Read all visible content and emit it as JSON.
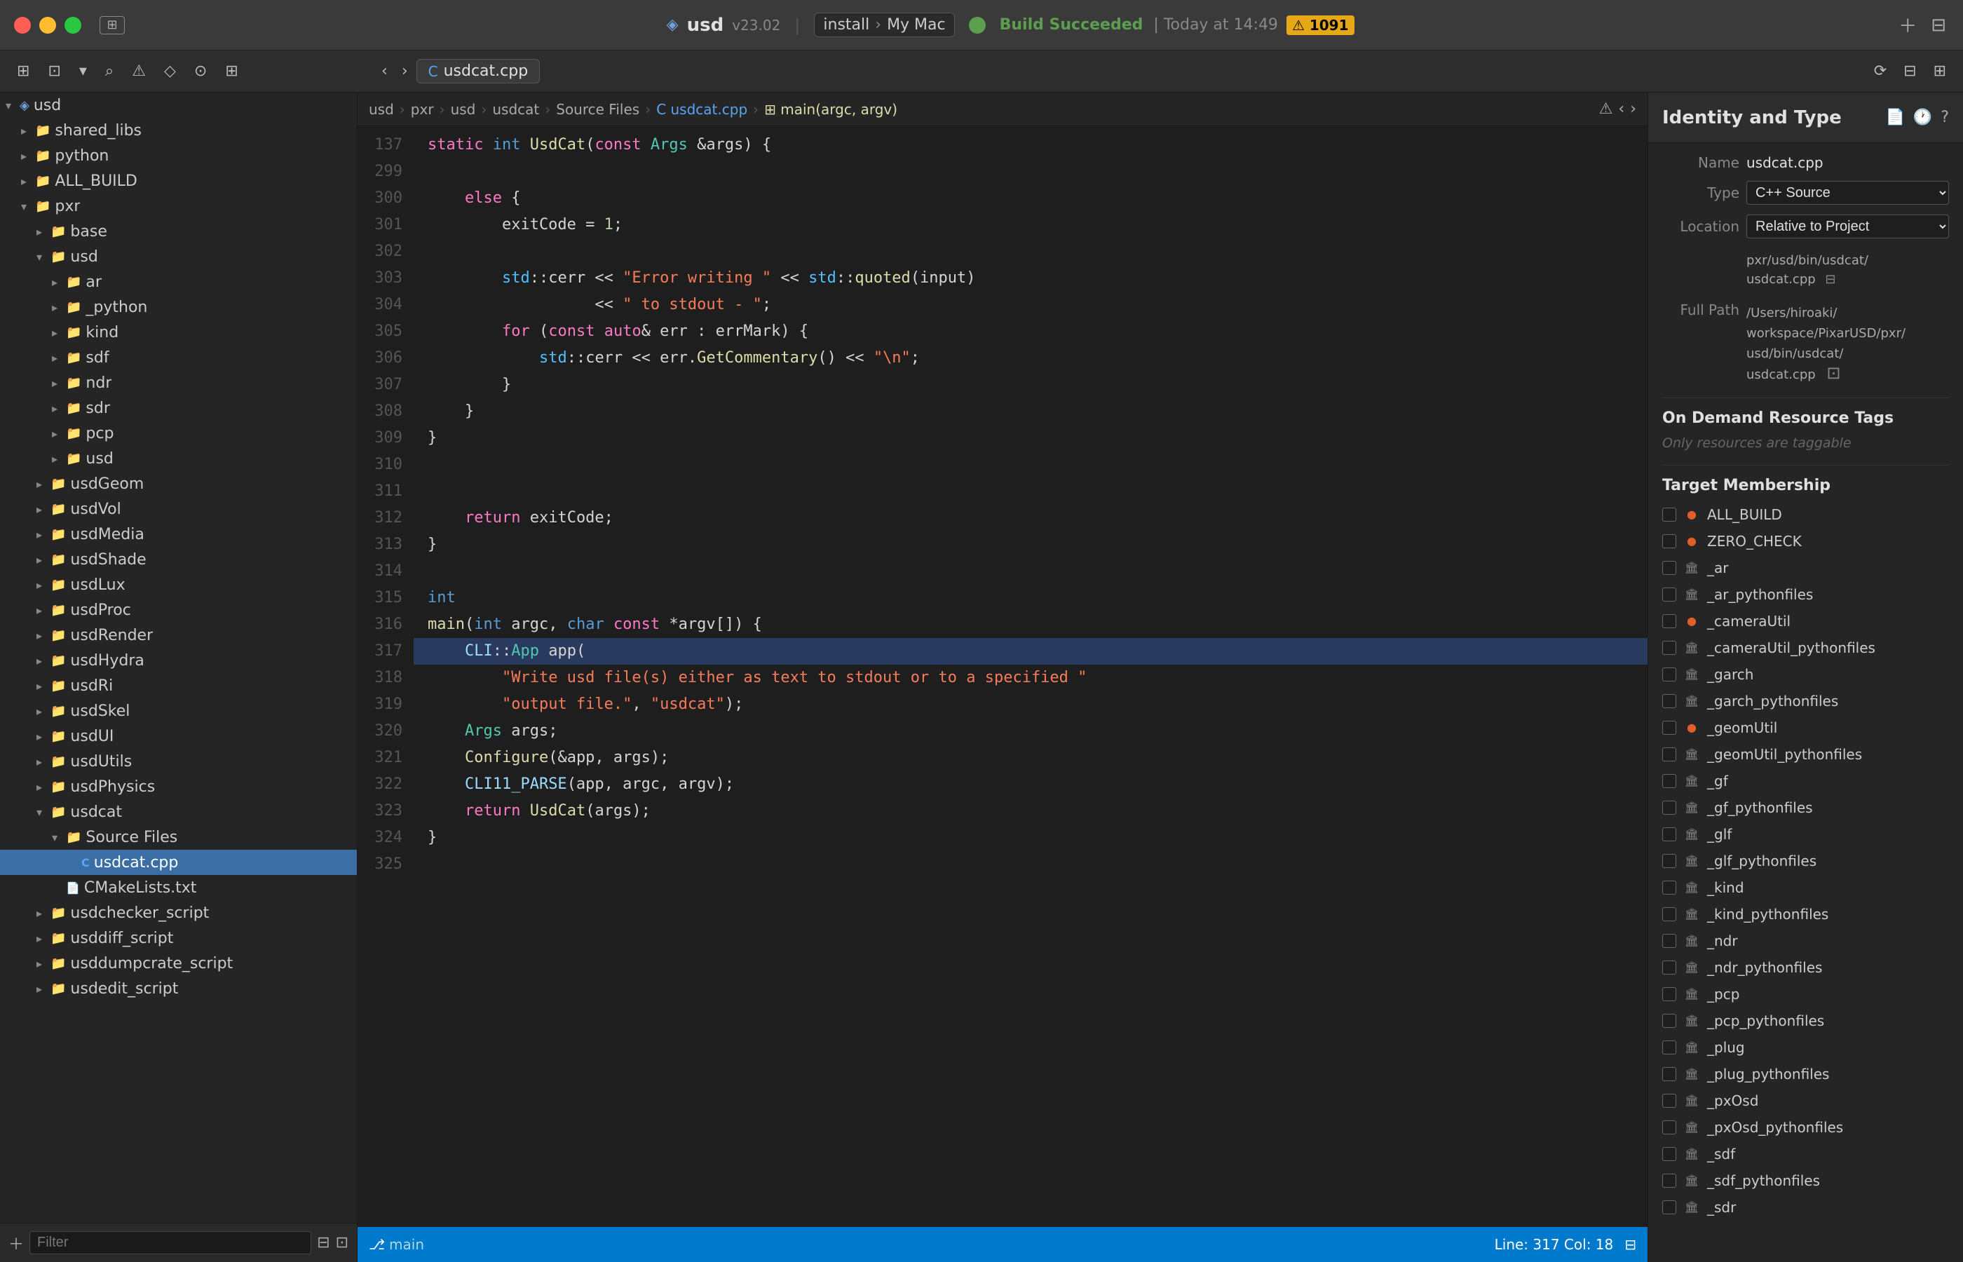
{
  "titlebar": {
    "project": "usd",
    "version": "v23.02",
    "scheme_install": "install",
    "device": "My Mac",
    "build_status": "Build Succeeded",
    "build_time": "Today at 14:49",
    "warning_count": "⚠ 1091"
  },
  "toolbar": {
    "tab_label": "usdcat.cpp",
    "nav_back": "‹",
    "nav_forward": "›"
  },
  "breadcrumb": {
    "items": [
      "usd",
      "pxr",
      "usd",
      "usdcat",
      "Source Files",
      "usdcat.cpp",
      "main(argc, argv)"
    ]
  },
  "sidebar": {
    "filter_placeholder": "Filter",
    "items": [
      {
        "id": "usd",
        "label": "usd",
        "indent": 0,
        "type": "root",
        "expanded": true
      },
      {
        "id": "shared_libs",
        "label": "shared_libs",
        "indent": 1,
        "type": "folder"
      },
      {
        "id": "python",
        "label": "python",
        "indent": 1,
        "type": "folder"
      },
      {
        "id": "ALL_BUILD",
        "label": "ALL_BUILD",
        "indent": 1,
        "type": "folder"
      },
      {
        "id": "pxr",
        "label": "pxr",
        "indent": 1,
        "type": "folder",
        "expanded": true
      },
      {
        "id": "base",
        "label": "base",
        "indent": 2,
        "type": "folder"
      },
      {
        "id": "usd-inner",
        "label": "usd",
        "indent": 2,
        "type": "folder",
        "expanded": true
      },
      {
        "id": "ar",
        "label": "ar",
        "indent": 3,
        "type": "folder"
      },
      {
        "id": "_python",
        "label": "_python",
        "indent": 3,
        "type": "folder"
      },
      {
        "id": "kind",
        "label": "kind",
        "indent": 3,
        "type": "folder"
      },
      {
        "id": "sdf",
        "label": "sdf",
        "indent": 3,
        "type": "folder"
      },
      {
        "id": "ndr",
        "label": "ndr",
        "indent": 3,
        "type": "folder"
      },
      {
        "id": "sdr",
        "label": "sdr",
        "indent": 3,
        "type": "folder"
      },
      {
        "id": "pcp",
        "label": "pcp",
        "indent": 3,
        "type": "folder"
      },
      {
        "id": "usd-leaf",
        "label": "usd",
        "indent": 3,
        "type": "folder"
      },
      {
        "id": "usdGeom",
        "label": "usdGeom",
        "indent": 2,
        "type": "folder"
      },
      {
        "id": "usdVol",
        "label": "usdVol",
        "indent": 2,
        "type": "folder"
      },
      {
        "id": "usdMedia",
        "label": "usdMedia",
        "indent": 2,
        "type": "folder"
      },
      {
        "id": "usdShade",
        "label": "usdShade",
        "indent": 2,
        "type": "folder"
      },
      {
        "id": "usdLux",
        "label": "usdLux",
        "indent": 2,
        "type": "folder"
      },
      {
        "id": "usdProc",
        "label": "usdProc",
        "indent": 2,
        "type": "folder"
      },
      {
        "id": "usdRender",
        "label": "usdRender",
        "indent": 2,
        "type": "folder"
      },
      {
        "id": "usdHydra",
        "label": "usdHydra",
        "indent": 2,
        "type": "folder"
      },
      {
        "id": "usdRi",
        "label": "usdRi",
        "indent": 2,
        "type": "folder"
      },
      {
        "id": "usdSkel",
        "label": "usdSkel",
        "indent": 2,
        "type": "folder"
      },
      {
        "id": "usdUI",
        "label": "usdUI",
        "indent": 2,
        "type": "folder"
      },
      {
        "id": "usdUtils",
        "label": "usdUtils",
        "indent": 2,
        "type": "folder"
      },
      {
        "id": "usdPhysics",
        "label": "usdPhysics",
        "indent": 2,
        "type": "folder"
      },
      {
        "id": "usdcat",
        "label": "usdcat",
        "indent": 2,
        "type": "folder",
        "expanded": true
      },
      {
        "id": "source_files",
        "label": "Source Files",
        "indent": 3,
        "type": "folder",
        "expanded": true
      },
      {
        "id": "usdcat_cpp",
        "label": "usdcat.cpp",
        "indent": 4,
        "type": "cpp",
        "selected": true
      },
      {
        "id": "CMakeLists",
        "label": "CMakeLists.txt",
        "indent": 3,
        "type": "cmake"
      },
      {
        "id": "usdchecker_script",
        "label": "usdchecker_script",
        "indent": 2,
        "type": "folder"
      },
      {
        "id": "usddiff_script",
        "label": "usddiff_script",
        "indent": 2,
        "type": "folder"
      },
      {
        "id": "usddumpcrate_script",
        "label": "usddumpcrate_script",
        "indent": 2,
        "type": "folder"
      },
      {
        "id": "usdedit_script",
        "label": "usdedit_script",
        "indent": 2,
        "type": "folder"
      }
    ]
  },
  "code": {
    "lines": [
      {
        "num": "137",
        "content": "static int UsdCat(const Args &args) {",
        "tokens": [
          {
            "text": "static ",
            "cls": "kw"
          },
          {
            "text": "int ",
            "cls": "kw2"
          },
          {
            "text": "UsdCat",
            "cls": "fn"
          },
          {
            "text": "(",
            "cls": "op"
          },
          {
            "text": "const ",
            "cls": "kw"
          },
          {
            "text": "Args",
            "cls": "type"
          },
          {
            "text": " &args) {",
            "cls": "op"
          }
        ]
      },
      {
        "num": "299",
        "content": "",
        "tokens": []
      },
      {
        "num": "300",
        "content": "    else {",
        "tokens": [
          {
            "text": "    "
          },
          {
            "text": "else",
            "cls": "kw"
          },
          {
            "text": " {",
            "cls": "op"
          }
        ]
      },
      {
        "num": "301",
        "content": "        exitCode = 1;",
        "tokens": [
          {
            "text": "        exitCode = "
          },
          {
            "text": "1",
            "cls": "num"
          },
          {
            "text": ";",
            "cls": "op"
          }
        ]
      },
      {
        "num": "302",
        "content": "",
        "tokens": []
      },
      {
        "num": "303",
        "content": "        std::cerr << \"Error writing \" << std::quoted(input)",
        "tokens": [
          {
            "text": "        "
          },
          {
            "text": "std",
            "cls": "ns"
          },
          {
            "text": "::cerr << "
          },
          {
            "text": "\"Error writing \"",
            "cls": "str"
          },
          {
            "text": " << "
          },
          {
            "text": "std",
            "cls": "ns"
          },
          {
            "text": "::"
          },
          {
            "text": "quoted",
            "cls": "fn"
          },
          {
            "text": "(input)",
            "cls": "op"
          }
        ]
      },
      {
        "num": "304",
        "content": "                  << \" to stdout - \";",
        "tokens": [
          {
            "text": "                  << "
          },
          {
            "text": "\" to stdout - \"",
            "cls": "str"
          },
          {
            "text": ";",
            "cls": "op"
          }
        ]
      },
      {
        "num": "305",
        "content": "        for (const auto& err : errMark) {",
        "tokens": [
          {
            "text": "        "
          },
          {
            "text": "for",
            "cls": "kw"
          },
          {
            "text": " ("
          },
          {
            "text": "const",
            "cls": "kw"
          },
          {
            "text": " "
          },
          {
            "text": "auto",
            "cls": "kw"
          },
          {
            "text": "& err : errMark) {",
            "cls": "op"
          }
        ]
      },
      {
        "num": "306",
        "content": "            std::cerr << err.GetCommentary() << \"\\n\";",
        "tokens": [
          {
            "text": "            "
          },
          {
            "text": "std",
            "cls": "ns"
          },
          {
            "text": "::cerr << err."
          },
          {
            "text": "GetCommentary",
            "cls": "fn"
          },
          {
            "text": "() << "
          },
          {
            "text": "\"\\n\"",
            "cls": "str"
          },
          {
            "text": ";",
            "cls": "op"
          }
        ]
      },
      {
        "num": "307",
        "content": "        }",
        "tokens": [
          {
            "text": "        }",
            "cls": "op"
          }
        ]
      },
      {
        "num": "308",
        "content": "    }",
        "tokens": [
          {
            "text": "    }",
            "cls": "op"
          }
        ]
      },
      {
        "num": "309",
        "content": "}",
        "tokens": [
          {
            "text": "}",
            "cls": "op"
          }
        ]
      },
      {
        "num": "310",
        "content": "",
        "tokens": []
      },
      {
        "num": "311",
        "content": "",
        "tokens": []
      },
      {
        "num": "312",
        "content": "    return exitCode;",
        "tokens": [
          {
            "text": "    "
          },
          {
            "text": "return",
            "cls": "kw"
          },
          {
            "text": " exitCode;",
            "cls": "op"
          }
        ]
      },
      {
        "num": "313",
        "content": "}",
        "tokens": [
          {
            "text": "}",
            "cls": "op"
          }
        ]
      },
      {
        "num": "314",
        "content": "",
        "tokens": []
      },
      {
        "num": "315",
        "content": "int",
        "tokens": [
          {
            "text": "int",
            "cls": "kw2"
          }
        ]
      },
      {
        "num": "316",
        "content": "main(int argc, char const *argv[]) {",
        "tokens": [
          {
            "text": "main",
            "cls": "fn"
          },
          {
            "text": "("
          },
          {
            "text": "int",
            "cls": "kw2"
          },
          {
            "text": " argc, "
          },
          {
            "text": "char",
            "cls": "kw2"
          },
          {
            "text": " "
          },
          {
            "text": "const",
            "cls": "kw"
          },
          {
            "text": " *argv[]) {",
            "cls": "op"
          }
        ]
      },
      {
        "num": "317",
        "content": "    CLI::App app(",
        "tokens": [
          {
            "text": "    "
          },
          {
            "text": "CLI",
            "cls": "macro"
          },
          {
            "text": "::"
          },
          {
            "text": "App",
            "cls": "type"
          },
          {
            "text": " app(",
            "cls": "op"
          }
        ],
        "active": true
      },
      {
        "num": "318",
        "content": "        \"Write usd file(s) either as text to stdout or to a specified \"",
        "tokens": [
          {
            "text": "        "
          },
          {
            "text": "\"Write usd file(s) either as text to stdout or to a specified \"",
            "cls": "str"
          }
        ]
      },
      {
        "num": "319",
        "content": "        \"output file.\", \"usdcat\");",
        "tokens": [
          {
            "text": "        "
          },
          {
            "text": "\"output file.\"",
            "cls": "str"
          },
          {
            "text": ", "
          },
          {
            "text": "\"usdcat\"",
            "cls": "str"
          },
          {
            "text": ");",
            "cls": "op"
          }
        ]
      },
      {
        "num": "320",
        "content": "    Args args;",
        "tokens": [
          {
            "text": "    "
          },
          {
            "text": "Args",
            "cls": "type"
          },
          {
            "text": " args;",
            "cls": "op"
          }
        ]
      },
      {
        "num": "321",
        "content": "    Configure(&app, args);",
        "tokens": [
          {
            "text": "    "
          },
          {
            "text": "Configure",
            "cls": "fn"
          },
          {
            "text": "(&app, args);",
            "cls": "op"
          }
        ]
      },
      {
        "num": "322",
        "content": "    CLI11_PARSE(app, argc, argv);",
        "tokens": [
          {
            "text": "    "
          },
          {
            "text": "CLI11_PARSE",
            "cls": "macro"
          },
          {
            "text": "(app, argc, argv);",
            "cls": "op"
          }
        ]
      },
      {
        "num": "323",
        "content": "    return UsdCat(args);",
        "tokens": [
          {
            "text": "    "
          },
          {
            "text": "return",
            "cls": "kw"
          },
          {
            "text": " "
          },
          {
            "text": "UsdCat",
            "cls": "fn"
          },
          {
            "text": "(args);",
            "cls": "op"
          }
        ]
      },
      {
        "num": "324",
        "content": "}",
        "tokens": [
          {
            "text": "}",
            "cls": "op"
          }
        ]
      },
      {
        "num": "325",
        "content": "",
        "tokens": []
      }
    ]
  },
  "statusbar": {
    "line_col": "Line: 317  Col: 18"
  },
  "inspector": {
    "title": "Identity and Type",
    "name_label": "Name",
    "name_value": "usdcat.cpp",
    "type_label": "Type",
    "type_value": "C++ Source",
    "location_label": "Location",
    "location_value": "Relative to Project",
    "path_short": "pxr/usd/bin/usdcat/\nusdcat.cpp",
    "full_path_label": "Full Path",
    "full_path_value": "/Users/hiroaki/workspace/PixarUSD/pxr/usd/bin/usdcat/usdcat.cpp",
    "on_demand_title": "On Demand Resource Tags",
    "tags_placeholder": "Only resources are taggable",
    "target_membership_title": "Target Membership",
    "targets": [
      {
        "label": "ALL_BUILD",
        "type": "orange"
      },
      {
        "label": "ZERO_CHECK",
        "type": "orange"
      },
      {
        "label": "_ar",
        "type": "library"
      },
      {
        "label": "_ar_pythonfiles",
        "type": "library"
      },
      {
        "label": "_cameraUtil",
        "type": "orange"
      },
      {
        "label": "_cameraUtil_pythonfiles",
        "type": "library"
      },
      {
        "label": "_garch",
        "type": "library"
      },
      {
        "label": "_garch_pythonfiles",
        "type": "library"
      },
      {
        "label": "_geomUtil",
        "type": "orange"
      },
      {
        "label": "_geomUtil_pythonfiles",
        "type": "library"
      },
      {
        "label": "_gf",
        "type": "library"
      },
      {
        "label": "_gf_pythonfiles",
        "type": "library"
      },
      {
        "label": "_glf",
        "type": "library"
      },
      {
        "label": "_glf_pythonfiles",
        "type": "library"
      },
      {
        "label": "_kind",
        "type": "library"
      },
      {
        "label": "_kind_pythonfiles",
        "type": "library"
      },
      {
        "label": "_ndr",
        "type": "library"
      },
      {
        "label": "_ndr_pythonfiles",
        "type": "library"
      },
      {
        "label": "_pcp",
        "type": "library"
      },
      {
        "label": "_pcp_pythonfiles",
        "type": "library"
      },
      {
        "label": "_plug",
        "type": "library"
      },
      {
        "label": "_plug_pythonfiles",
        "type": "library"
      },
      {
        "label": "_pxOsd",
        "type": "library"
      },
      {
        "label": "_pxOsd_pythonfiles",
        "type": "library"
      },
      {
        "label": "_sdf",
        "type": "library"
      },
      {
        "label": "_sdf_pythonfiles",
        "type": "library"
      },
      {
        "label": "_sdr",
        "type": "library"
      }
    ]
  }
}
